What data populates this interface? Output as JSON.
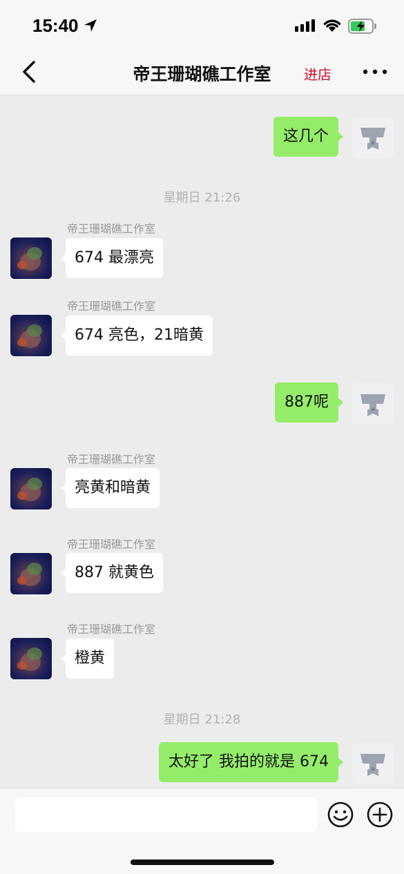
{
  "status_bar": {
    "time": "15:40"
  },
  "nav": {
    "title": "帝王珊瑚礁工作室",
    "store_label": "进店"
  },
  "messages": {
    "m1": "这几个",
    "t1": "星期日 21:26",
    "s1_name": "帝王珊瑚礁工作室",
    "s1": "674 最漂亮",
    "s2_name": "帝王珊瑚礁工作室",
    "s2": "674 亮色，21暗黄",
    "m2": "887呢",
    "s3_name": "帝王珊瑚礁工作室",
    "s3": "亮黄和暗黄",
    "s4_name": "帝王珊瑚礁工作室",
    "s4": "887 就黄色",
    "s5_name": "帝王珊瑚礁工作室",
    "s5": "橙黄",
    "t2": "星期日 21:28",
    "m3": "太好了 我拍的就是 674"
  },
  "input": {
    "value": "",
    "placeholder": ""
  },
  "icons": {
    "back": "chevron-left-icon",
    "more": "more-dots-icon",
    "emoji": "smiley-icon",
    "add": "plus-circle-icon"
  },
  "colors": {
    "my_bubble": "#95ec69",
    "store_link": "#c8102e",
    "chat_bg": "#ececec"
  }
}
